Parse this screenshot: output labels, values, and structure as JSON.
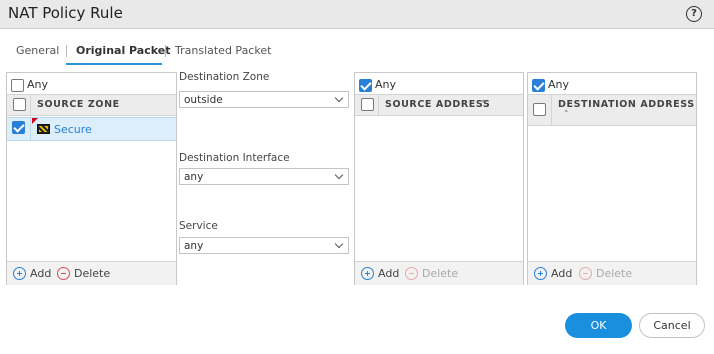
{
  "window": {
    "title": "NAT Policy Rule",
    "help_icon": "?"
  },
  "tabs": [
    {
      "label": "General"
    },
    {
      "label": "Original Packet",
      "active": true
    },
    {
      "label": "Translated Packet"
    }
  ],
  "source_zone_panel": {
    "any_label": "Any",
    "any_checked": false,
    "header": "SOURCE ZONE",
    "rows": [
      {
        "label": "Secure",
        "checked": true
      }
    ],
    "add_label": "Add",
    "delete_label": "Delete"
  },
  "middle": {
    "destination_zone": {
      "label": "Destination Zone",
      "value": "outside"
    },
    "destination_interface": {
      "label": "Destination Interface",
      "value": "any"
    },
    "service": {
      "label": "Service",
      "value": "any"
    }
  },
  "source_address_panel": {
    "any_label": "Any",
    "any_checked": true,
    "header": "SOURCE ADDRESS",
    "add_label": "Add",
    "delete_label": "Delete"
  },
  "destination_address_panel": {
    "any_label": "Any",
    "any_checked": true,
    "header": "DESTINATION ADDRESS",
    "add_label": "Add",
    "delete_label": "Delete"
  },
  "buttons": {
    "ok": "OK",
    "cancel": "Cancel"
  },
  "colors": {
    "accent": "#2a7fd6",
    "ok_button": "#1a8fdd",
    "selected_row": "#dceefa"
  }
}
